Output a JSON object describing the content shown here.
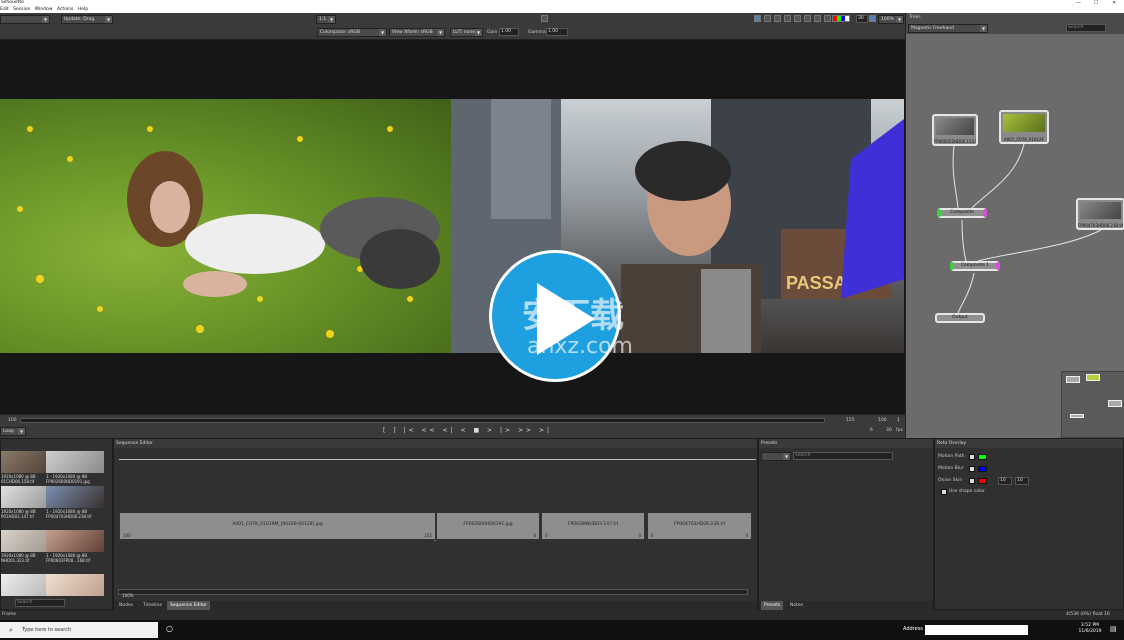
{
  "window": {
    "title": "Silhouette",
    "min": "—",
    "max": "☐",
    "close": "✕"
  },
  "menu": [
    "Edit",
    "Session",
    "Window",
    "Actions",
    "Help"
  ],
  "toolbar": {
    "update_mode": "Update: Drag",
    "zoom_ratio": "1:1",
    "colorspace": "Colorspace: sRGB",
    "view_transform": "View Xform: sRGB",
    "lut": "LUT: none",
    "gain_label": "Gain",
    "gain_value": "1.00",
    "gamma_label": "Gamma",
    "gamma_value": "1.00",
    "frame_field": "30",
    "zoom_percent": "100%"
  },
  "watermark": {
    "cn": "安下载",
    "en": "anxz.com"
  },
  "timeline": {
    "start": "100",
    "end": "155",
    "current": "100",
    "step": "1",
    "loop_mode": "Loop",
    "frame": "6",
    "fps": "30",
    "fps_unit": "fps"
  },
  "transport": [
    "[",
    "]",
    "|<",
    "<<",
    "<|",
    "<",
    "■",
    ">",
    "|>",
    ">>",
    ">|"
  ],
  "nodes": {
    "title": "Trees",
    "tool": "Magnetic Freehand",
    "search_placeholder": "Search",
    "items": [
      {
        "label": "FP000052HD06.153.tif"
      },
      {
        "label": "A001_C078_0101XF"
      },
      {
        "label": "FP004703HD06.238.tif"
      }
    ],
    "composite_a": "Composite",
    "composite_b": "Composite 1",
    "output": "Output"
  },
  "media": {
    "items": [
      {
        "line1": "1920x1080 @ 8B",
        "line2": "01CHD06.158.tif"
      },
      {
        "line1": "1 - 1920x1080 @ 8B",
        "line2": "FP002600HD0191.jpg"
      },
      {
        "line1": "1920x1080 @ 8B",
        "line2": "P01HD03.147.tif"
      },
      {
        "line1": "1 - 1920x1080 @ 8B",
        "line2": "FP004703HD06.238.tif"
      },
      {
        "line1": "1920x1080 @ 8B",
        "line2": "NHD01.323.tif"
      },
      {
        "line1": "1 - 1920x1080 @ 8B",
        "line2": "FP00603FP00...168.tif"
      }
    ],
    "search_placeholder": "Search"
  },
  "sequence": {
    "title": "Sequence Editor",
    "clips": [
      {
        "label": "A001_C078_01019M_[00100-00128].jpg",
        "start": "100",
        "end": "102"
      },
      {
        "label": "FP002600HD0191.jpg",
        "start": "",
        "end": "0"
      },
      {
        "label": "FP0039INHD03.147.tif",
        "start": "0",
        "end": "0"
      },
      {
        "label": "FP004703HD06.238.tif",
        "start": "0",
        "end": "0"
      }
    ],
    "zoom": "100%",
    "tabs": [
      "Nodes",
      "Timeline",
      "Sequence Editor"
    ]
  },
  "presets": {
    "title": "Presets",
    "search_placeholder": "Search",
    "tabs": [
      "Presets",
      "Notes"
    ]
  },
  "roto": {
    "title": "Roto Overlay",
    "rows": [
      {
        "label": "Motion Path",
        "color": "#00ff00"
      },
      {
        "label": "Motion Blur",
        "color": "#0000ff"
      },
      {
        "label": "Onion Skin",
        "color": "#ff0000",
        "v1": "10",
        "v2": "10"
      }
    ],
    "use_shape_color": "Use shape color"
  },
  "status": {
    "memory": "4/536 (0%) float 16",
    "left": "Frame"
  },
  "taskbar": {
    "search_placeholder": "Type here to search",
    "address_label": "Address",
    "time": "3:52 PM",
    "date": "11/6/2019"
  }
}
